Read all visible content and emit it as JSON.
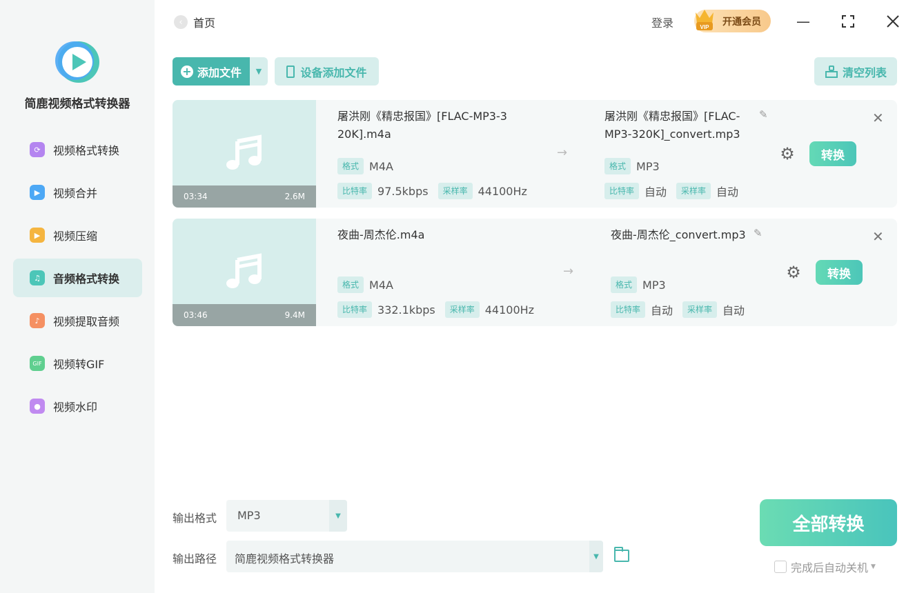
{
  "app": {
    "name": "简鹿视频格式转换器"
  },
  "sidebar": {
    "items": [
      {
        "label": "视频格式转换",
        "icon": "video-convert-icon",
        "color": "#b485f0",
        "active": false
      },
      {
        "label": "视频合并",
        "icon": "video-merge-icon",
        "color": "#4da8f5",
        "active": false
      },
      {
        "label": "视频压缩",
        "icon": "video-compress-icon",
        "color": "#f5b540",
        "active": false
      },
      {
        "label": "音频格式转换",
        "icon": "audio-convert-icon",
        "color": "#4cc6b8",
        "active": true
      },
      {
        "label": "视频提取音频",
        "icon": "extract-audio-icon",
        "color": "#f59062",
        "active": false
      },
      {
        "label": "视频转GIF",
        "icon": "gif-icon",
        "color": "#5fcf8f",
        "active": false
      },
      {
        "label": "视频水印",
        "icon": "watermark-icon",
        "color": "#c08af0",
        "active": false
      }
    ]
  },
  "topbar": {
    "home": "首页",
    "login": "登录",
    "vip": "开通会员"
  },
  "toolbar": {
    "add_file": "添加文件",
    "device_add": "设备添加文件",
    "clear_list": "清空列表"
  },
  "labels": {
    "format": "格式",
    "bitrate": "比特率",
    "samplerate": "采样率",
    "convert": "转换"
  },
  "files": [
    {
      "duration": "03:34",
      "size": "2.6M",
      "source_name": "屠洪刚《精忠报国》[FLAC-MP3-320K].m4a",
      "source_name_line1": "屠洪刚《精忠报国》[FLAC-MP3-3",
      "source_name_line2": "20K].m4a",
      "source_format": "M4A",
      "source_bitrate": "97.5kbps",
      "source_samplerate": "44100Hz",
      "target_name_line1": "屠洪刚《精忠报国》[FLAC-",
      "target_name_line2": "MP3-320K]_convert.mp3",
      "target_format": "MP3",
      "target_bitrate": "自动",
      "target_samplerate": "自动"
    },
    {
      "duration": "03:46",
      "size": "9.4M",
      "source_name_line1": "夜曲-周杰伦.m4a",
      "source_format": "M4A",
      "source_bitrate": "332.1kbps",
      "source_samplerate": "44100Hz",
      "target_name_line1": "夜曲-周杰伦_convert.mp3",
      "target_format": "MP3",
      "target_bitrate": "自动",
      "target_samplerate": "自动"
    }
  ],
  "bottom": {
    "output_format_label": "输出格式",
    "output_format_value": "MP3",
    "output_path_label": "输出路径",
    "output_path_value": "简鹿视频格式转换器",
    "convert_all": "全部转换",
    "auto_shutdown": "完成后自动关机"
  },
  "colors": {
    "accent": "#48b7ad",
    "accent_light": "#d7eeec"
  }
}
